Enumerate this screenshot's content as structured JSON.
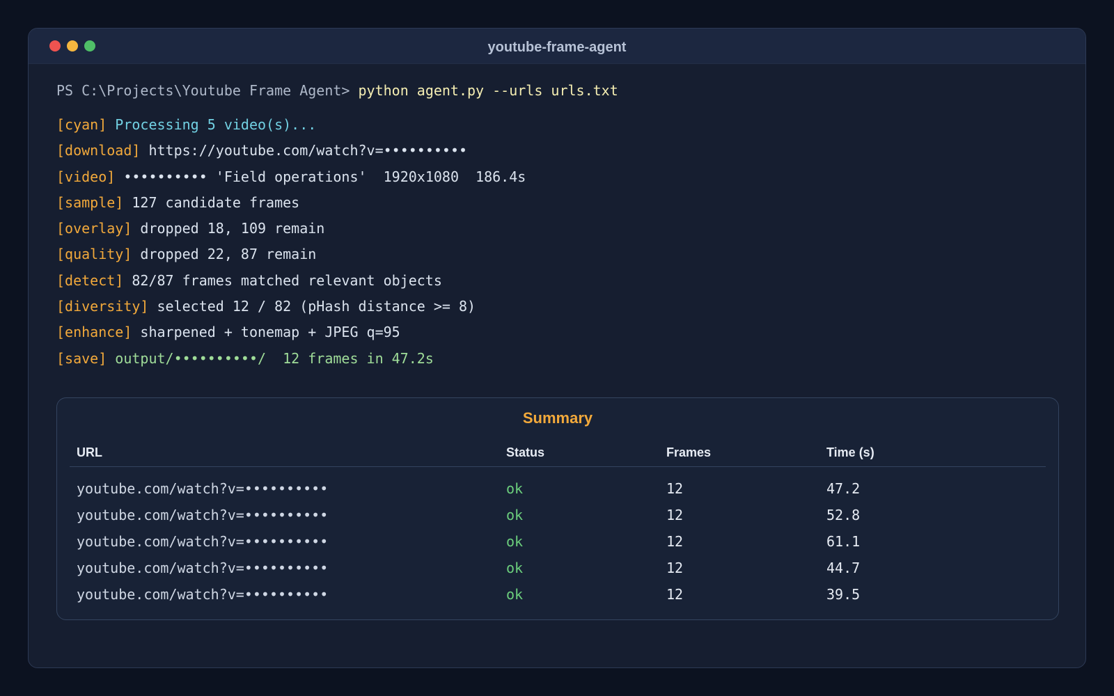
{
  "window": {
    "title": "youtube-frame-agent"
  },
  "terminal": {
    "prompt": "PS C:\\Projects\\Youtube Frame Agent> ",
    "command": "python agent.py --urls urls.txt",
    "lines": [
      {
        "tag": "[cyan]",
        "text": " Processing 5 video(s)...",
        "color": "cyan"
      },
      {
        "tag": "[download]",
        "text": " https://youtube.com/watch?v=••••••••••",
        "color": "default"
      },
      {
        "tag": "[video]",
        "text": " •••••••••• 'Field operations'  1920x1080  186.4s",
        "color": "default"
      },
      {
        "tag": "[sample]",
        "text": " 127 candidate frames",
        "color": "default"
      },
      {
        "tag": "[overlay]",
        "text": " dropped 18, 109 remain",
        "color": "default"
      },
      {
        "tag": "[quality]",
        "text": " dropped 22, 87 remain",
        "color": "default"
      },
      {
        "tag": "[detect]",
        "text": " 82/87 frames matched relevant objects",
        "color": "default"
      },
      {
        "tag": "[diversity]",
        "text": " selected 12 / 82 (pHash distance >= 8)",
        "color": "default"
      },
      {
        "tag": "[enhance]",
        "text": " sharpened + tonemap + JPEG q=95",
        "color": "default"
      },
      {
        "tag": "[save]",
        "text": " output/••••••••••/  12 frames in 47.2s",
        "color": "green"
      }
    ]
  },
  "summary": {
    "title": "Summary",
    "columns": [
      "URL",
      "Status",
      "Frames",
      "Time (s)"
    ],
    "rows": [
      {
        "url": "youtube.com/watch?v=••••••••••",
        "status": "ok",
        "frames": "12",
        "time": "47.2"
      },
      {
        "url": "youtube.com/watch?v=••••••••••",
        "status": "ok",
        "frames": "12",
        "time": "52.8"
      },
      {
        "url": "youtube.com/watch?v=••••••••••",
        "status": "ok",
        "frames": "12",
        "time": "61.1"
      },
      {
        "url": "youtube.com/watch?v=••••••••••",
        "status": "ok",
        "frames": "12",
        "time": "44.7"
      },
      {
        "url": "youtube.com/watch?v=••••••••••",
        "status": "ok",
        "frames": "12",
        "time": "39.5"
      }
    ]
  },
  "colors": {
    "tag": "#f2a93b",
    "ok": "#6ccf7d",
    "cyan": "#72d1e3",
    "green": "#9fdc98"
  }
}
